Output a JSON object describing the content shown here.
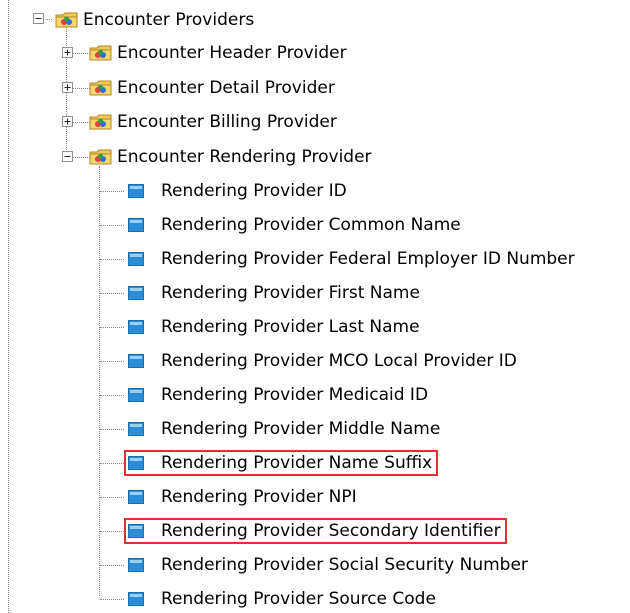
{
  "tree": {
    "root": {
      "label": "Encounter Providers",
      "expanded": true,
      "icon": "folder-icon",
      "children": [
        {
          "label": "Encounter Header Provider",
          "expanded": false,
          "icon": "folder-icon"
        },
        {
          "label": "Encounter Detail Provider",
          "expanded": false,
          "icon": "folder-icon"
        },
        {
          "label": "Encounter Billing Provider",
          "expanded": false,
          "icon": "folder-icon"
        },
        {
          "label": "Encounter Rendering Provider",
          "expanded": true,
          "icon": "folder-icon",
          "fields": [
            {
              "label": "Rendering Provider ID",
              "highlighted": false
            },
            {
              "label": "Rendering Provider Common Name",
              "highlighted": false
            },
            {
              "label": "Rendering Provider Federal Employer ID Number",
              "highlighted": false
            },
            {
              "label": "Rendering Provider First Name",
              "highlighted": false
            },
            {
              "label": "Rendering Provider Last Name",
              "highlighted": false
            },
            {
              "label": "Rendering Provider MCO Local Provider ID",
              "highlighted": false
            },
            {
              "label": "Rendering Provider Medicaid ID",
              "highlighted": false
            },
            {
              "label": "Rendering Provider Middle Name",
              "highlighted": false
            },
            {
              "label": "Rendering Provider Name Suffix",
              "highlighted": true
            },
            {
              "label": "Rendering Provider NPI",
              "highlighted": false
            },
            {
              "label": "Rendering Provider Secondary Identifier",
              "highlighted": true
            },
            {
              "label": "Rendering Provider Social Security Number",
              "highlighted": false
            },
            {
              "label": "Rendering Provider Source Code",
              "highlighted": false
            }
          ]
        }
      ]
    }
  },
  "colors": {
    "highlight_border": "#e03030",
    "field_icon": "#2a8fd8",
    "folder": "#e8b84a"
  }
}
